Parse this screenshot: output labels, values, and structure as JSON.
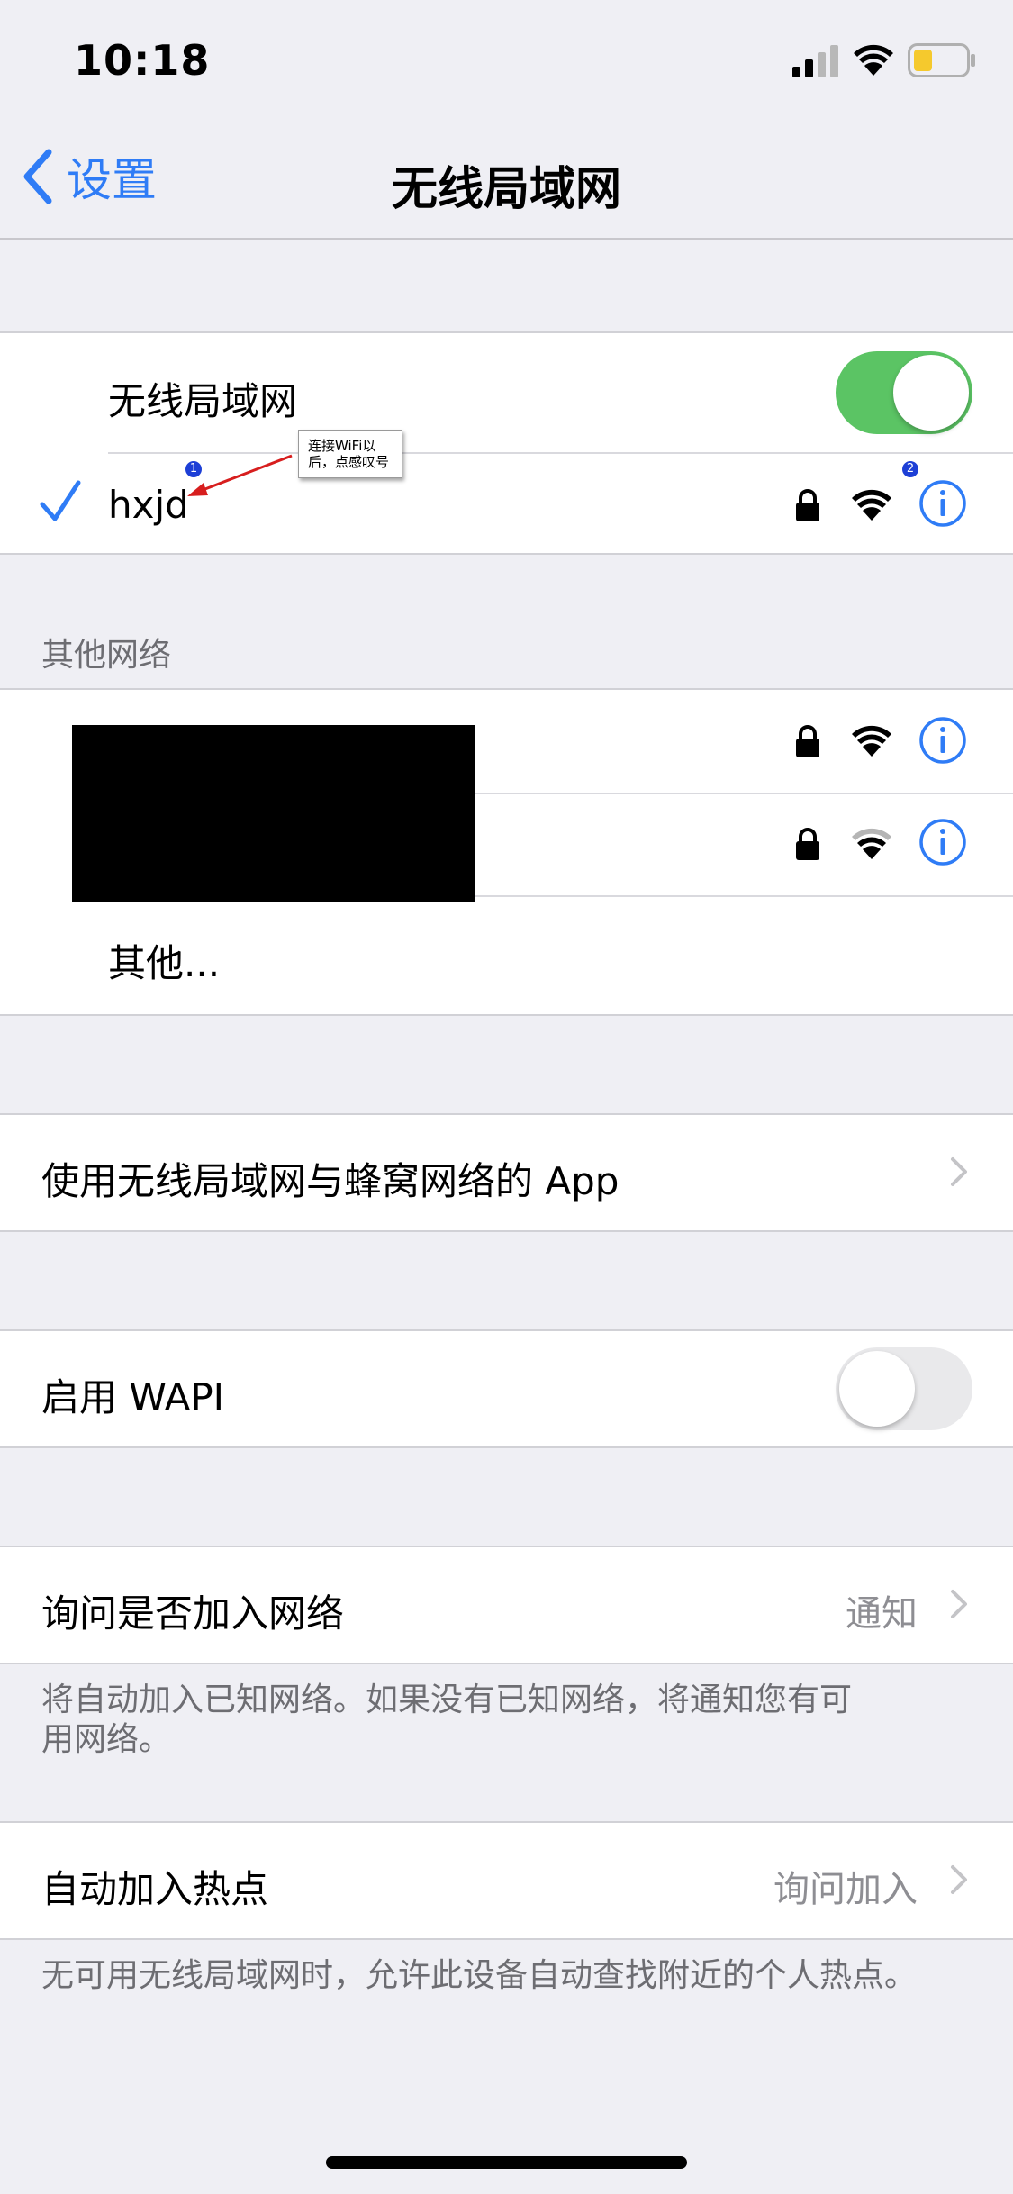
{
  "status_bar": {
    "time": "10:18"
  },
  "nav": {
    "back_label": "设置",
    "title": "无线局域网"
  },
  "wifi_group": {
    "toggle_label": "无线局域网",
    "toggle_on": true,
    "connected_network": "hxjd"
  },
  "annotation": {
    "callout_text": "连接WiFi以后，点感叹号",
    "badge_1": "1",
    "badge_2": "2"
  },
  "other_networks": {
    "header": "其他网络",
    "other_label": "其他..."
  },
  "apps_row": {
    "label": "使用无线局域网与蜂窝网络的 App"
  },
  "wapi": {
    "label": "启用 WAPI",
    "toggle_on": false
  },
  "ask_join": {
    "label": "询问是否加入网络",
    "value": "通知",
    "footer": "将自动加入已知网络。如果没有已知网络，将通知您有可用网络。"
  },
  "auto_hotspot": {
    "label": "自动加入热点",
    "value": "询问加入",
    "footer": "无可用无线局域网时，允许此设备自动查找附近的个人热点。"
  },
  "colors": {
    "accent": "#2f7cf6",
    "toggle_on": "#5bc464",
    "toggle_off": "#e9e9eb",
    "background": "#efeff4"
  }
}
